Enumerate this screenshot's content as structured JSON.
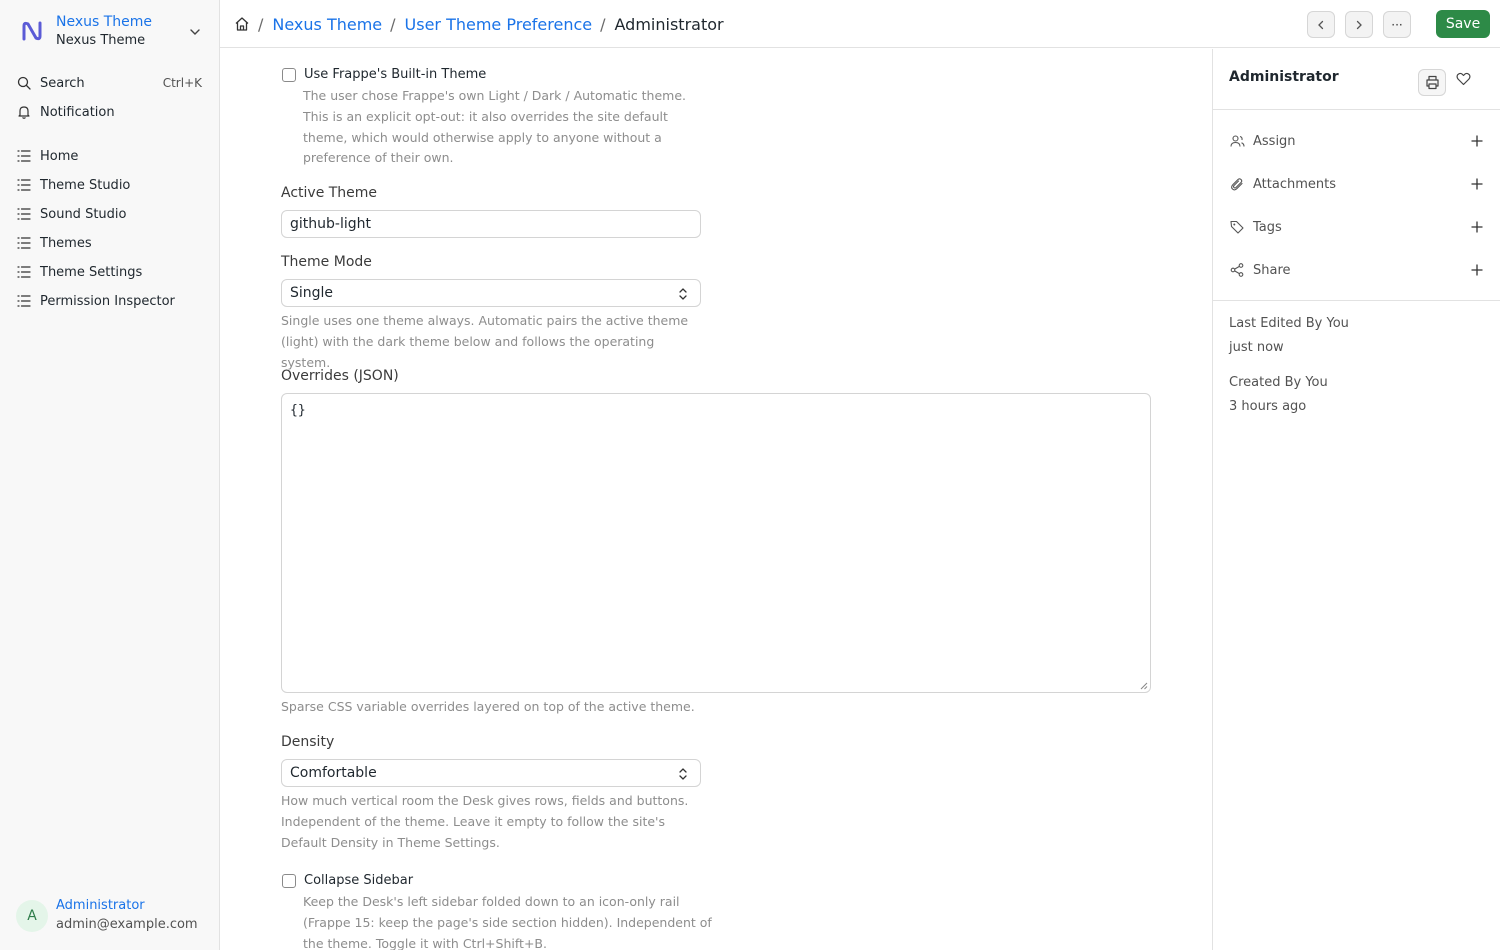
{
  "brand": {
    "title": "Nexus Theme",
    "subtitle": "Nexus Theme"
  },
  "sidebar": {
    "search_label": "Search",
    "search_shortcut": "Ctrl+K",
    "notification_label": "Notification",
    "items": [
      {
        "label": "Home"
      },
      {
        "label": "Theme Studio"
      },
      {
        "label": "Sound Studio"
      },
      {
        "label": "Themes"
      },
      {
        "label": "Theme Settings"
      },
      {
        "label": "Permission Inspector"
      }
    ]
  },
  "user": {
    "initial": "A",
    "name": "Administrator",
    "email": "admin@example.com"
  },
  "breadcrumb": {
    "sep": "/",
    "items": [
      "Nexus Theme",
      "User Theme Preference"
    ],
    "current": "Administrator"
  },
  "toolbar": {
    "more_label": "···",
    "save_label": "Save"
  },
  "form": {
    "builtin": {
      "label": "Use Frappe's Built-in Theme",
      "help": "The user chose Frappe's own Light / Dark / Automatic theme. This is an explicit opt-out: it also overrides the site default theme, which would otherwise apply to anyone without a preference of their own."
    },
    "active_theme": {
      "label": "Active Theme",
      "value": "github-light"
    },
    "theme_mode": {
      "label": "Theme Mode",
      "value": "Single",
      "help": "Single uses one theme always. Automatic pairs the active theme (light) with the dark theme below and follows the operating system."
    },
    "overrides": {
      "label": "Overrides (JSON)",
      "value": "{}",
      "help": "Sparse CSS variable overrides layered on top of the active theme."
    },
    "density": {
      "label": "Density",
      "value": "Comfortable",
      "help": "How much vertical room the Desk gives rows, fields and buttons. Independent of the theme. Leave it empty to follow the site's Default Density in Theme Settings."
    },
    "collapse_sidebar": {
      "label": "Collapse Sidebar",
      "help": "Keep the Desk's left sidebar folded down to an icon-only rail (Frappe 15: keep the page's side section hidden). Independent of the theme. Toggle it with Ctrl+Shift+B."
    }
  },
  "doc_sidebar": {
    "title": "Administrator",
    "rows": [
      {
        "label": "Assign"
      },
      {
        "label": "Attachments"
      },
      {
        "label": "Tags"
      },
      {
        "label": "Share"
      }
    ],
    "last_edited_label": "Last Edited By You",
    "last_edited_value": "just now",
    "created_label": "Created By You",
    "created_value": "3 hours ago"
  },
  "colors": {
    "accent": "#1a73e8",
    "save": "#2d8a47",
    "logo": "#5b5bd6"
  }
}
